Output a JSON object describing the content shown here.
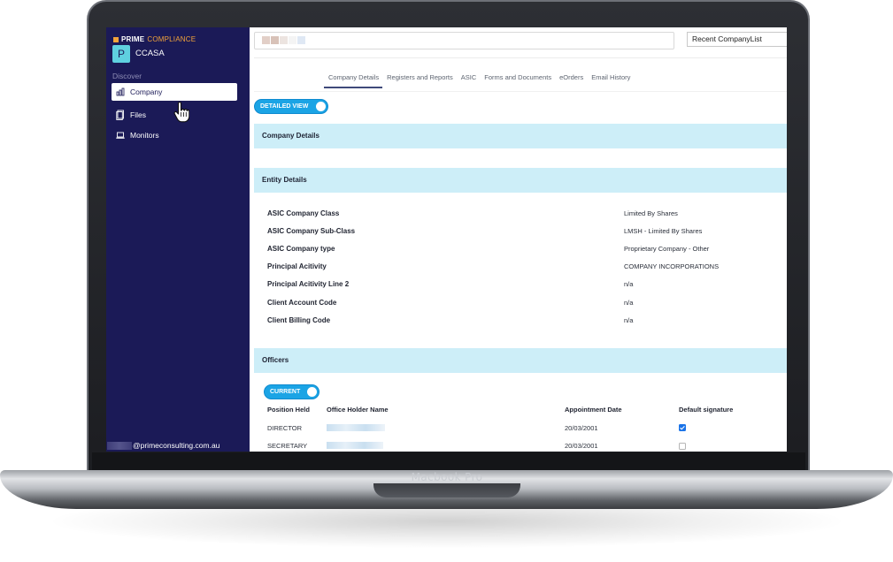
{
  "device": {
    "label": "Macbook Pro"
  },
  "app": {
    "logo_prime": "PRIME",
    "logo_compliance": "COMPLIANCE",
    "org_initial": "P",
    "org_name": "CCASA",
    "section_label": "Discover",
    "user_email_suffix": "@primeconsulting.com.au"
  },
  "sidebar": {
    "items": [
      {
        "label": "Company",
        "icon": "bar-chart-icon",
        "active": true
      },
      {
        "label": "Files",
        "icon": "file-icon",
        "active": false
      },
      {
        "label": "Monitors",
        "icon": "laptop-icon",
        "active": false
      }
    ]
  },
  "header": {
    "company_select": "Recent CompanyList"
  },
  "tabs": [
    {
      "label": "Company Details",
      "active": true
    },
    {
      "label": "Registers and Reports"
    },
    {
      "label": "ASIC"
    },
    {
      "label": "Forms and Documents"
    },
    {
      "label": "eOrders"
    },
    {
      "label": "Email History"
    }
  ],
  "view_toggle": {
    "label": "DETAILED VIEW",
    "on": true
  },
  "sections": {
    "company_details": "Company Details",
    "entity_details": "Entity Details",
    "officers": "Officers"
  },
  "entity_details": [
    {
      "label": "ASIC Company Class",
      "value": "Limited By Shares"
    },
    {
      "label": "ASIC Company Sub-Class",
      "value": "LMSH - Limited By Shares"
    },
    {
      "label": "ASIC Company type",
      "value": "Proprietary Company - Other"
    },
    {
      "label": "Principal Acitivity",
      "value": "COMPANY INCORPORATIONS"
    },
    {
      "label": "Principal Acitivity Line 2",
      "value": "n/a"
    },
    {
      "label": "Client Account Code",
      "value": "n/a"
    },
    {
      "label": "Client Billing Code",
      "value": "n/a"
    }
  ],
  "officers": {
    "filter_toggle": {
      "label": "CURRENT",
      "on": true
    },
    "columns": [
      "Position Held",
      "Office Holder Name",
      "Appointment Date",
      "Default signature"
    ],
    "rows": [
      {
        "position": "DIRECTOR",
        "appointment_date": "20/03/2001",
        "default_signature": true
      },
      {
        "position": "SECRETARY",
        "appointment_date": "20/03/2001",
        "default_signature": false
      }
    ]
  },
  "colors": {
    "sidebar": "#1b1a57",
    "accent": "#1ba4e5",
    "section_bar": "#cdeef8",
    "logo_orange": "#f2a33a"
  }
}
